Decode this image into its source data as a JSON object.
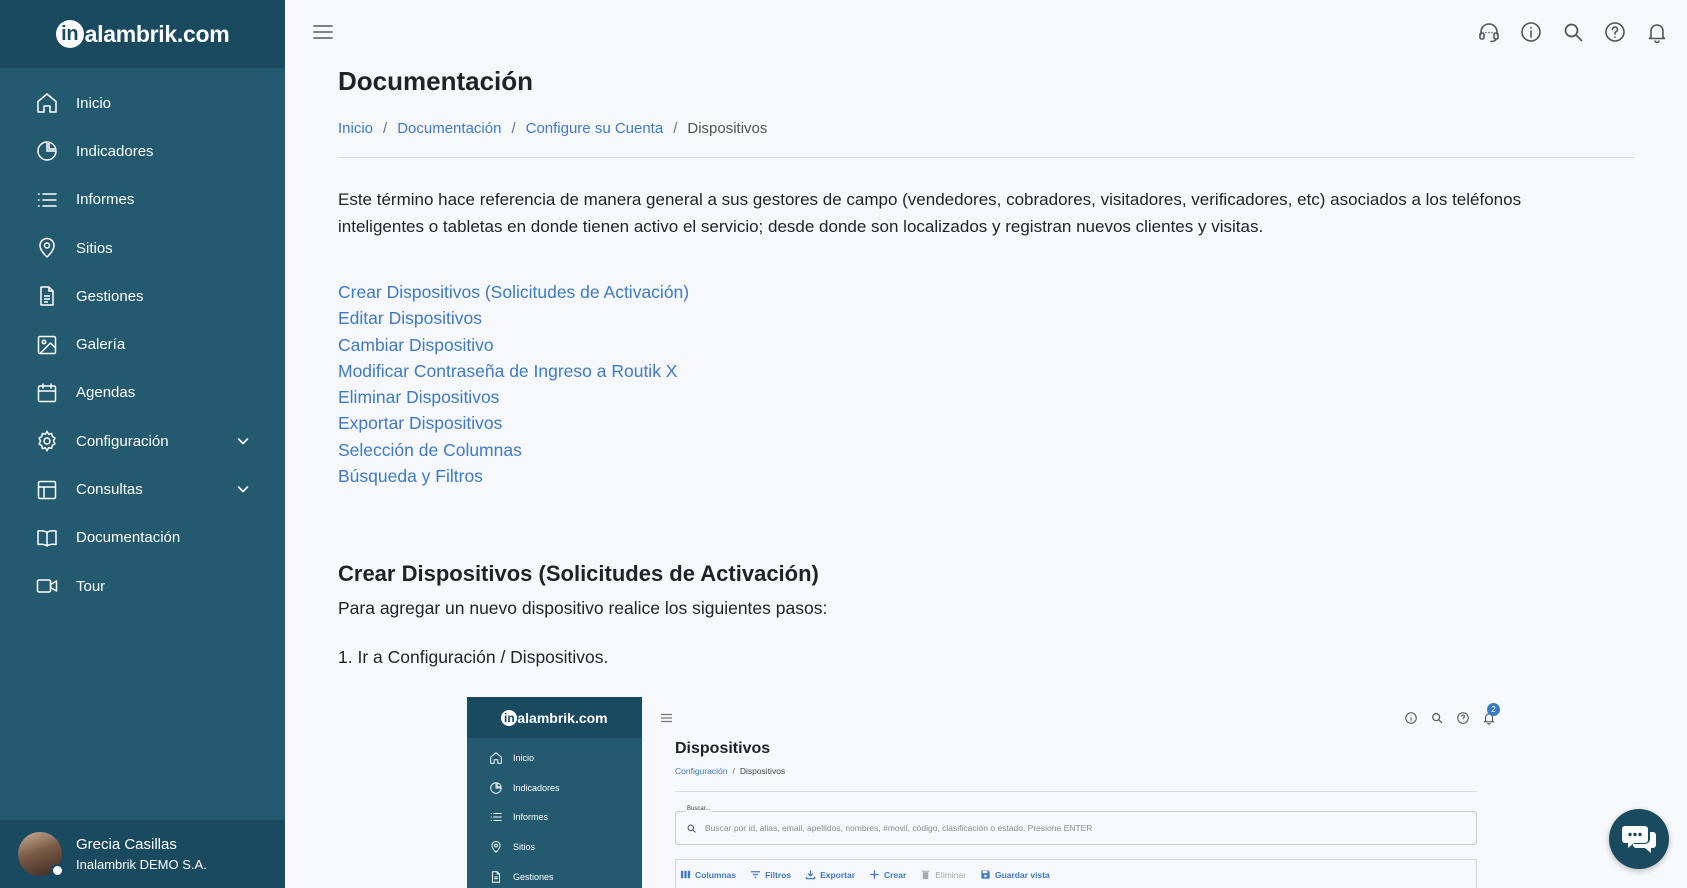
{
  "sidebar": {
    "brand": {
      "logo_initial": "in",
      "logo_rest": "alambrik.com"
    },
    "items": [
      {
        "label": "Inicio",
        "icon": "home-icon"
      },
      {
        "label": "Indicadores",
        "icon": "pie-chart-icon"
      },
      {
        "label": "Informes",
        "icon": "list-icon"
      },
      {
        "label": "Sitios",
        "icon": "map-pin-icon"
      },
      {
        "label": "Gestiones",
        "icon": "document-icon"
      },
      {
        "label": "Galería",
        "icon": "image-icon"
      },
      {
        "label": "Agendas",
        "icon": "calendar-icon"
      },
      {
        "label": "Configuración",
        "icon": "gear-icon",
        "expandable": true
      },
      {
        "label": "Consultas",
        "icon": "table-icon",
        "expandable": true
      },
      {
        "label": "Documentación",
        "icon": "book-icon"
      },
      {
        "label": "Tour",
        "icon": "video-icon"
      }
    ],
    "user": {
      "name": "Grecia Casillas",
      "company": "Inalambrik DEMO S.A."
    }
  },
  "topbar": {
    "icons": [
      "headset-icon",
      "info-icon",
      "search-icon",
      "help-icon",
      "bell-icon"
    ]
  },
  "page": {
    "title": "Documentación",
    "breadcrumb": [
      {
        "label": "Inicio",
        "link": true
      },
      {
        "label": "Documentación",
        "link": true
      },
      {
        "label": "Configure su Cuenta",
        "link": true
      },
      {
        "label": "Dispositivos",
        "link": false
      }
    ],
    "intro": "Este término hace referencia de manera general a sus gestores de campo (vendedores, cobradores, visitadores, verificadores, etc) asociados a los teléfonos inteligentes o tabletas en donde tienen activo el servicio; desde donde son localizados y registran nuevos clientes y visitas.",
    "links": [
      "Crear Dispositivos (Solicitudes de Activación)",
      "Editar Dispositivos",
      "Cambiar Dispositivo",
      "Modificar Contraseña de Ingreso a Routik X",
      "Eliminar Dispositivos",
      "Exportar Dispositivos",
      "Selección de Columnas",
      "Búsqueda y Filtros"
    ],
    "section_title": "Crear Dispositivos (Solicitudes de Activación)",
    "section_text": "Para agregar un nuevo dispositivo realice los siguientes pasos:",
    "step1": "1. Ir a Configuración / Dispositivos."
  },
  "screenshot": {
    "logo_initial": "in",
    "logo_rest": "alambrik.com",
    "nav": [
      "Inicio",
      "Indicadores",
      "Informes",
      "Sitios",
      "Gestiones"
    ],
    "badge": "2",
    "title": "Dispositivos",
    "breadcrumb_link": "Configuración",
    "breadcrumb_current": "Dispositivos",
    "search_label": "Buscar...",
    "search_placeholder": "Buscar por id, alias, email, apellidos, nombres, #movil, código, clasificación o estado. Presione ENTER",
    "toolbar": [
      "Columnas",
      "Filtros",
      "Exportar",
      "Crear",
      "Eliminar",
      "Guardar vista"
    ]
  },
  "colors": {
    "sidebar": "#235a70",
    "sidebar_dark": "#1a4a5f",
    "link": "#3f7ac4",
    "background": "#f6f8fb"
  }
}
